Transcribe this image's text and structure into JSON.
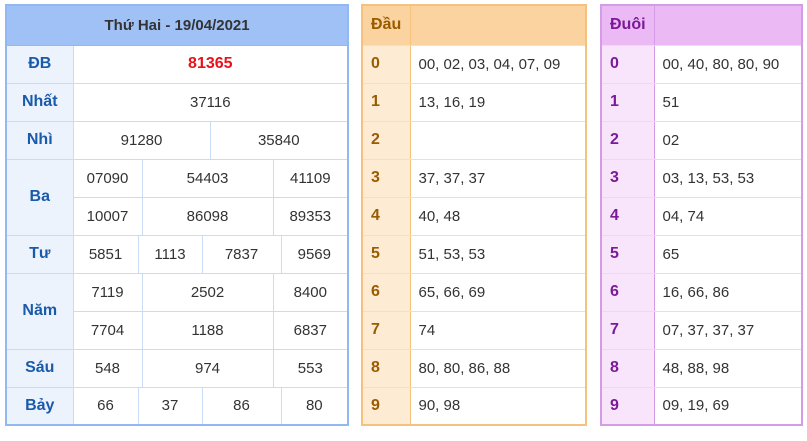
{
  "results": {
    "title": "Thứ Hai - 19/04/2021",
    "special": {
      "label": "ĐB",
      "value": "81365"
    },
    "first": {
      "label": "Nhất",
      "value": "37116"
    },
    "second": {
      "label": "Nhì",
      "values": [
        "91280",
        "35840"
      ]
    },
    "third": {
      "label": "Ba",
      "values": [
        "07090",
        "54403",
        "41109",
        "10007",
        "86098",
        "89353"
      ]
    },
    "fourth": {
      "label": "Tư",
      "values": [
        "5851",
        "1113",
        "7837",
        "9569"
      ]
    },
    "fifth": {
      "label": "Năm",
      "values": [
        "7119",
        "2502",
        "8400",
        "7704",
        "1188",
        "6837"
      ]
    },
    "sixth": {
      "label": "Sáu",
      "values": [
        "548",
        "974",
        "553"
      ]
    },
    "seventh": {
      "label": "Bảy",
      "values": [
        "66",
        "37",
        "86",
        "80"
      ]
    }
  },
  "dau": {
    "header": "Đầu",
    "rows": [
      {
        "key": "0",
        "values": "00, 02, 03, 04, 07, 09"
      },
      {
        "key": "1",
        "values": "13, 16, 19"
      },
      {
        "key": "2",
        "values": ""
      },
      {
        "key": "3",
        "values": "37, 37, 37"
      },
      {
        "key": "4",
        "values": "40, 48"
      },
      {
        "key": "5",
        "values": "51, 53, 53"
      },
      {
        "key": "6",
        "values": "65, 66, 69"
      },
      {
        "key": "7",
        "values": "74"
      },
      {
        "key": "8",
        "values": "80, 80, 86, 88"
      },
      {
        "key": "9",
        "values": "90, 98"
      }
    ]
  },
  "duoi": {
    "header": "Đuôi",
    "rows": [
      {
        "key": "0",
        "values": "00, 40, 80, 80, 90"
      },
      {
        "key": "1",
        "values": "51"
      },
      {
        "key": "2",
        "values": "02"
      },
      {
        "key": "3",
        "values": "03, 13, 53, 53"
      },
      {
        "key": "4",
        "values": "04, 74"
      },
      {
        "key": "5",
        "values": "65"
      },
      {
        "key": "6",
        "values": "16, 66, 86"
      },
      {
        "key": "7",
        "values": "07, 37, 37, 37"
      },
      {
        "key": "8",
        "values": "48, 88, 98"
      },
      {
        "key": "9",
        "values": "09, 19, 69"
      }
    ]
  }
}
